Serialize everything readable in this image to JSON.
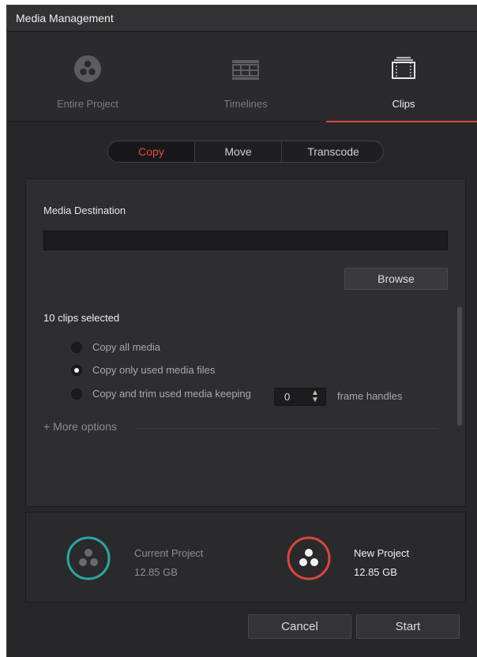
{
  "window": {
    "title": "Media Management"
  },
  "modes": [
    {
      "label": "Entire Project",
      "icon": "resolve-logo-icon",
      "active": false
    },
    {
      "label": "Timelines",
      "icon": "timeline-icon",
      "active": false
    },
    {
      "label": "Clips",
      "icon": "clip-film-icon",
      "active": true
    }
  ],
  "operation_tabs": {
    "copy": "Copy",
    "move": "Move",
    "transcode": "Transcode",
    "selected": "Copy"
  },
  "destination": {
    "label": "Media Destination",
    "value": "",
    "placeholder": "",
    "browse_label": "Browse"
  },
  "selection": {
    "count_label": "10 clips selected"
  },
  "options": {
    "copy_all": "Copy all media",
    "copy_used": "Copy only used media files",
    "copy_trim": "Copy and trim used media keeping",
    "frame_handles_value": "0",
    "frame_handles_suffix": "frame handles",
    "selected": "copy_used",
    "more_options": "+ More options"
  },
  "projects": {
    "current": {
      "label": "Current Project",
      "size": "12.85 GB"
    },
    "new": {
      "label": "New Project",
      "size": "12.85 GB"
    }
  },
  "buttons": {
    "cancel": "Cancel",
    "start": "Start"
  },
  "colors": {
    "accent": "#e0453a",
    "current_ring": "#2aa7a1",
    "new_ring": "#d8473b",
    "background": "#27272a"
  }
}
